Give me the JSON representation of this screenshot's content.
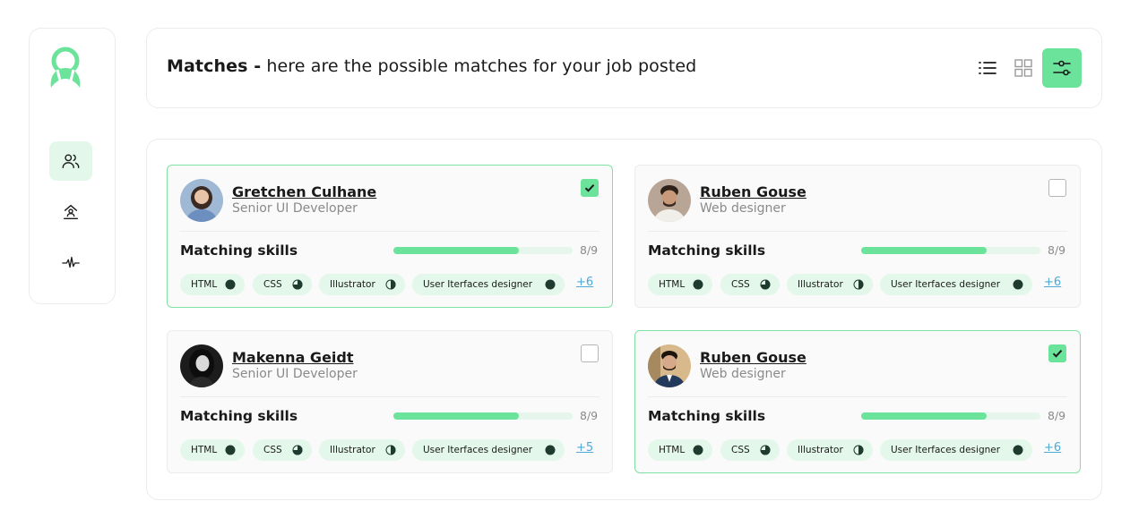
{
  "header": {
    "title_strong": "Matches -",
    "title_rest": " here are the possible matches for your job posted"
  },
  "colors": {
    "accent": "#6ce39a",
    "accent_light": "#e3f8ea",
    "link": "#4fa9d6",
    "muted": "#8a8a8a"
  },
  "sidebar": {
    "items": [
      {
        "icon": "users-icon",
        "active": true
      },
      {
        "icon": "upload-person-icon",
        "active": false
      },
      {
        "icon": "activity-icon",
        "active": false
      }
    ]
  },
  "view_buttons": [
    {
      "icon": "list-view-icon",
      "active": false
    },
    {
      "icon": "grid-view-icon",
      "active": false
    },
    {
      "icon": "filter-sliders-icon",
      "active": true
    }
  ],
  "matches": [
    {
      "name": "Gretchen Culhane",
      "role": "Senior UI Developer",
      "checked": true,
      "skills_label": "Matching skills",
      "progress": 0.7,
      "progress_text": "8/9",
      "tags": [
        {
          "label": "HTML",
          "level": 1.0
        },
        {
          "label": "CSS",
          "level": 0.75
        },
        {
          "label": "Illustrator",
          "level": 0.5
        },
        {
          "label": "User Iterfaces designer",
          "level": 1.0
        }
      ],
      "more": "+6"
    },
    {
      "name": "Ruben Gouse",
      "role": "Web designer",
      "checked": false,
      "skills_label": "Matching skills",
      "progress": 0.7,
      "progress_text": "8/9",
      "tags": [
        {
          "label": "HTML",
          "level": 1.0
        },
        {
          "label": "CSS",
          "level": 0.75
        },
        {
          "label": "Illustrator",
          "level": 0.5
        },
        {
          "label": "User Iterfaces designer",
          "level": 1.0
        }
      ],
      "more": "+6"
    },
    {
      "name": "Makenna Geidt",
      "role": "Senior UI Developer",
      "checked": false,
      "skills_label": "Matching skills",
      "progress": 0.7,
      "progress_text": "8/9",
      "tags": [
        {
          "label": "HTML",
          "level": 1.0
        },
        {
          "label": "CSS",
          "level": 0.75
        },
        {
          "label": "Illustrator",
          "level": 0.5
        },
        {
          "label": "User Iterfaces designer",
          "level": 1.0
        }
      ],
      "more": "+5"
    },
    {
      "name": "Ruben Gouse",
      "role": "Web designer",
      "checked": true,
      "skills_label": "Matching skills",
      "progress": 0.7,
      "progress_text": "8/9",
      "tags": [
        {
          "label": "HTML",
          "level": 1.0
        },
        {
          "label": "CSS",
          "level": 0.75
        },
        {
          "label": "Illustrator",
          "level": 0.5
        },
        {
          "label": "User Iterfaces designer",
          "level": 1.0
        }
      ],
      "more": "+6"
    }
  ]
}
